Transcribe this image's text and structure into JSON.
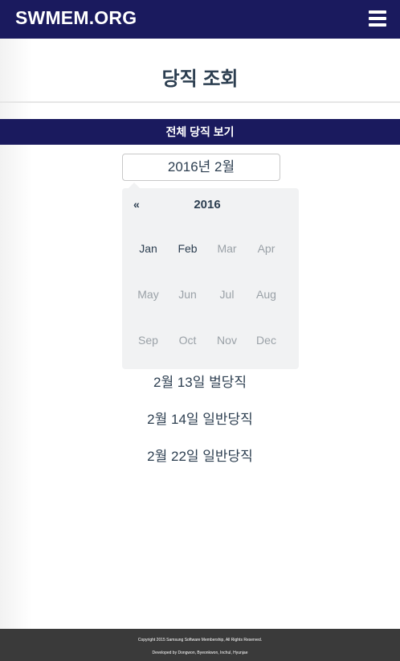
{
  "header": {
    "brand": "SWMEM.ORG",
    "menu_icon": "hamburger-icon"
  },
  "page": {
    "title": "당직 조회"
  },
  "section": {
    "view_all_label": "전체 당직 보기"
  },
  "month_input": {
    "value": "2016년 2월"
  },
  "picker": {
    "prev_label": "«",
    "year": "2016",
    "months": [
      {
        "label": "Jan",
        "available": true
      },
      {
        "label": "Feb",
        "available": true
      },
      {
        "label": "Mar",
        "available": false
      },
      {
        "label": "Apr",
        "available": false
      },
      {
        "label": "May",
        "available": false
      },
      {
        "label": "Jun",
        "available": false
      },
      {
        "label": "Jul",
        "available": false
      },
      {
        "label": "Aug",
        "available": false
      },
      {
        "label": "Sep",
        "available": false
      },
      {
        "label": "Oct",
        "available": false
      },
      {
        "label": "Nov",
        "available": false
      },
      {
        "label": "Dec",
        "available": false
      }
    ]
  },
  "duties": [
    {
      "label": "2월 13일 벌당직"
    },
    {
      "label": "2월 14일 일반당직"
    },
    {
      "label": "2월 22일 일반당직"
    }
  ],
  "footer": {
    "copyright": "Copyright 2015 Samsung Software Membership, All Rights Reserved.",
    "developers": "Developed by Dongwon, Byeonkwon, Inchul, Hyunjae"
  },
  "colors": {
    "navbar": "#1a1a5e",
    "text": "#2c3e50",
    "muted": "#9aa1a7",
    "footer": "#3a3a3a"
  }
}
